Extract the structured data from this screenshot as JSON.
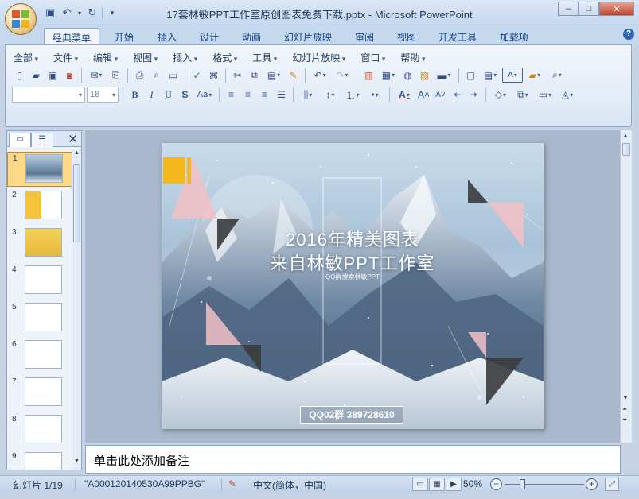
{
  "window": {
    "title": "17套林敏PPT工作室原创图表免费下载.pptx - Microsoft PowerPoint",
    "controls": [
      "–",
      "□",
      "✕"
    ]
  },
  "ribbon_tabs": [
    "经典菜单",
    "开始",
    "插入",
    "设计",
    "动画",
    "幻灯片放映",
    "审阅",
    "视图",
    "开发工具",
    "加载项"
  ],
  "classic_menu": [
    "全部",
    "文件",
    "编辑",
    "视图",
    "插入",
    "格式",
    "工具",
    "幻灯片放映",
    "窗口",
    "帮助"
  ],
  "font_size": "18",
  "font_name": "",
  "slide_pane": {
    "numbers": [
      "1",
      "2",
      "3",
      "4",
      "5",
      "6",
      "7",
      "8",
      "9"
    ],
    "selected_index": 0
  },
  "slide": {
    "title_line1": "2016年精美图表",
    "title_line2": "来自林敏PPT工作室",
    "subtitle": "QQ群搜索林敏PPT",
    "qq_box": "QQ02群 389728610",
    "colors": {
      "pink": "#f2bfc6",
      "dark": "#3a3b3d",
      "yellow": "#f5b81b",
      "sky": "#b9cde0"
    }
  },
  "notes": {
    "placeholder": "单击此处添加备注"
  },
  "status": {
    "slide_info": "幻灯片 1/19",
    "theme": "\"A000120140530A99PPBG\"",
    "language": "中文(简体，中国)",
    "zoom": "50%"
  }
}
